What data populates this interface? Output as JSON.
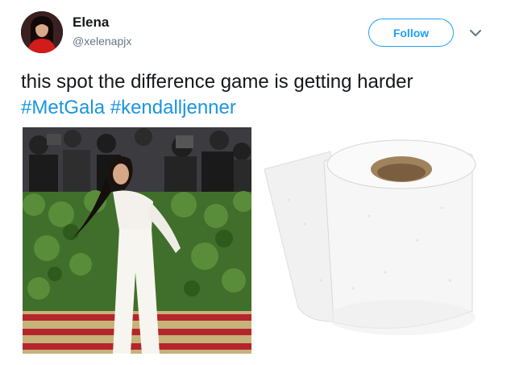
{
  "user": {
    "display_name": "Elena",
    "handle": "@xelenapjx"
  },
  "follow_button": {
    "label": "Follow"
  },
  "tweet": {
    "text_prefix": "this spot the difference game is getting harder ",
    "hashtags": [
      "#MetGala",
      "#kendalljenner"
    ]
  },
  "media": [
    {
      "icon": "photo-red-carpet"
    },
    {
      "icon": "photo-toilet-paper-roll"
    }
  ],
  "colors": {
    "accent": "#1da1f2",
    "hashtag": "#1b95e0",
    "text": "#14171a",
    "muted": "#657786"
  }
}
